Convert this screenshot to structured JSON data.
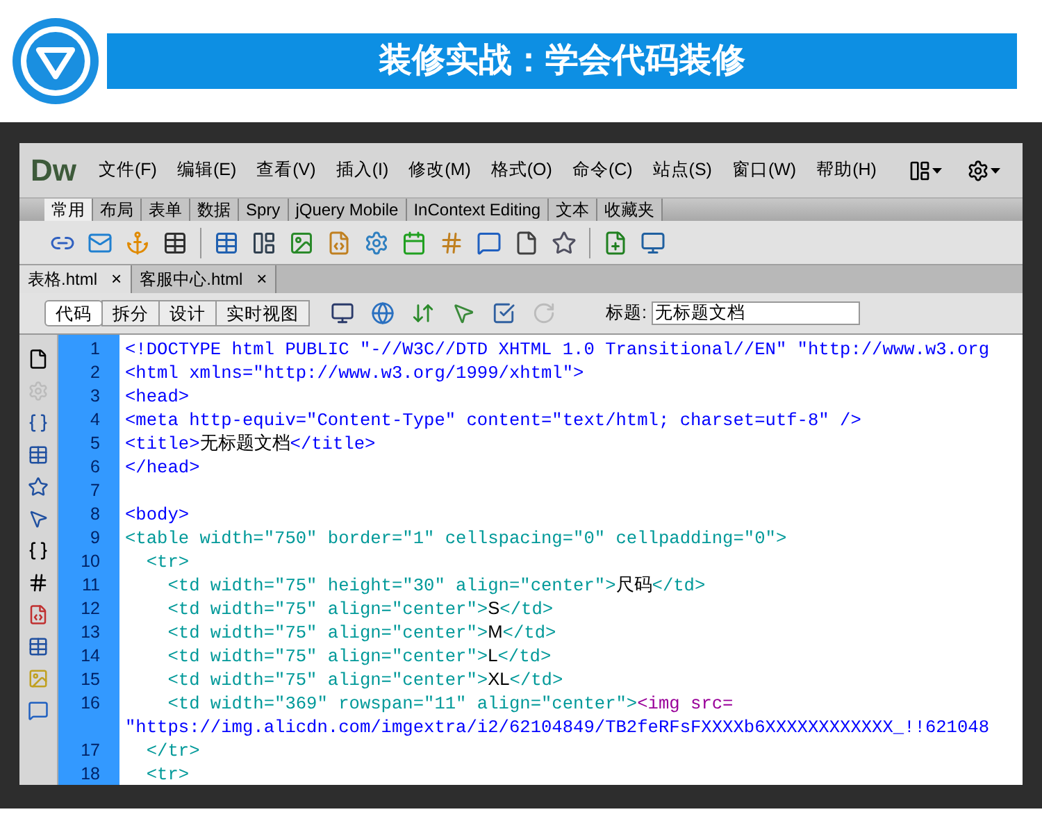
{
  "banner": {
    "title": "装修实战：学会代码装修"
  },
  "app": {
    "logo": "Dw",
    "menus": [
      "文件(F)",
      "编辑(E)",
      "查看(V)",
      "插入(I)",
      "修改(M)",
      "格式(O)",
      "命令(C)",
      "站点(S)",
      "窗口(W)",
      "帮助(H)"
    ],
    "insert_tabs": [
      {
        "label": "常用",
        "selected": true
      },
      {
        "label": "布局",
        "selected": false
      },
      {
        "label": "表单",
        "selected": false
      },
      {
        "label": "数据",
        "selected": false
      },
      {
        "label": "Spry",
        "selected": false
      },
      {
        "label": "jQuery Mobile",
        "selected": false
      },
      {
        "label": "InContext Editing",
        "selected": false
      },
      {
        "label": "文本",
        "selected": false
      },
      {
        "label": "收藏夹",
        "selected": false
      }
    ],
    "file_tabs": [
      {
        "label": "表格.html",
        "close": "×",
        "selected": true
      },
      {
        "label": "客服中心.html",
        "close": "×",
        "selected": false
      }
    ],
    "view_buttons": [
      {
        "label": "代码",
        "selected": true
      },
      {
        "label": "拆分",
        "selected": false
      },
      {
        "label": "设计",
        "selected": false
      },
      {
        "label": "实时视图",
        "selected": false
      }
    ],
    "title_label": "标题:",
    "title_value": "无标题文档"
  },
  "code": [
    {
      "number": "1",
      "segments": [
        {
          "kind": "markup",
          "text": "<!DOCTYPE html PUBLIC \"-//W3C//DTD XHTML 1.0 Transitional//EN\" \"http://www.w3.org"
        }
      ]
    },
    {
      "number": "2",
      "segments": [
        {
          "kind": "markup",
          "text": "<html xmlns=\"http://www.w3.org/1999/xhtml\">"
        }
      ]
    },
    {
      "number": "3",
      "segments": [
        {
          "kind": "markup",
          "text": "<head>"
        }
      ]
    },
    {
      "number": "4",
      "segments": [
        {
          "kind": "markup",
          "text": "<meta http-equiv=\"Content-Type\" content=\"text/html; charset=utf-8\" />"
        }
      ]
    },
    {
      "number": "5",
      "segments": [
        {
          "kind": "markup",
          "text": "<title>"
        },
        {
          "kind": "text",
          "text": "无标题文档"
        },
        {
          "kind": "markup",
          "text": "</title>"
        }
      ]
    },
    {
      "number": "6",
      "segments": [
        {
          "kind": "markup",
          "text": "</head>"
        }
      ]
    },
    {
      "number": "7"
    },
    {
      "number": "8",
      "segments": [
        {
          "kind": "markup",
          "text": "<body>"
        }
      ]
    },
    {
      "number": "9",
      "segments": [
        {
          "kind": "table",
          "text": "<table width=\"750\" border=\"1\" cellspacing=\"0\" cellpadding=\"0\">"
        }
      ]
    },
    {
      "number": "10",
      "segments": [
        {
          "kind": "table",
          "text": "  <tr>"
        }
      ]
    },
    {
      "number": "11",
      "segments": [
        {
          "kind": "table",
          "text": "    <td width=\"75\" height=\"30\" align=\"center\">"
        },
        {
          "kind": "text",
          "text": "尺码"
        },
        {
          "kind": "table",
          "text": "</td>"
        }
      ]
    },
    {
      "number": "12",
      "segments": [
        {
          "kind": "table",
          "text": "    <td width=\"75\" align=\"center\">"
        },
        {
          "kind": "text",
          "text": "S"
        },
        {
          "kind": "table",
          "text": "</td>"
        }
      ]
    },
    {
      "number": "13",
      "segments": [
        {
          "kind": "table",
          "text": "    <td width=\"75\" align=\"center\">"
        },
        {
          "kind": "text",
          "text": "M"
        },
        {
          "kind": "table",
          "text": "</td>"
        }
      ]
    },
    {
      "number": "14",
      "segments": [
        {
          "kind": "table",
          "text": "    <td width=\"75\" align=\"center\">"
        },
        {
          "kind": "text",
          "text": "L"
        },
        {
          "kind": "table",
          "text": "</td>"
        }
      ]
    },
    {
      "number": "15",
      "segments": [
        {
          "kind": "table",
          "text": "    <td width=\"75\" align=\"center\">"
        },
        {
          "kind": "text",
          "text": "XL"
        },
        {
          "kind": "table",
          "text": "</td>"
        }
      ]
    },
    {
      "number": "16",
      "segments": [
        {
          "kind": "table",
          "text": "    <td width=\"369\" rowspan=\"11\" align=\"center\">"
        },
        {
          "kind": "image",
          "text": "<img src="
        }
      ]
    },
    {
      "segments": [
        {
          "kind": "markup",
          "text": "\"https://img.alicdn.com/imgextra/i2/62104849/TB2feRFsFXXXXb6XXXXXXXXXXXX_!!621048"
        }
      ]
    },
    {
      "number": "17",
      "segments": [
        {
          "kind": "table",
          "text": "  </tr>"
        }
      ]
    },
    {
      "number": "18",
      "segments": [
        {
          "kind": "table",
          "text": "  <tr>"
        }
      ]
    }
  ]
}
